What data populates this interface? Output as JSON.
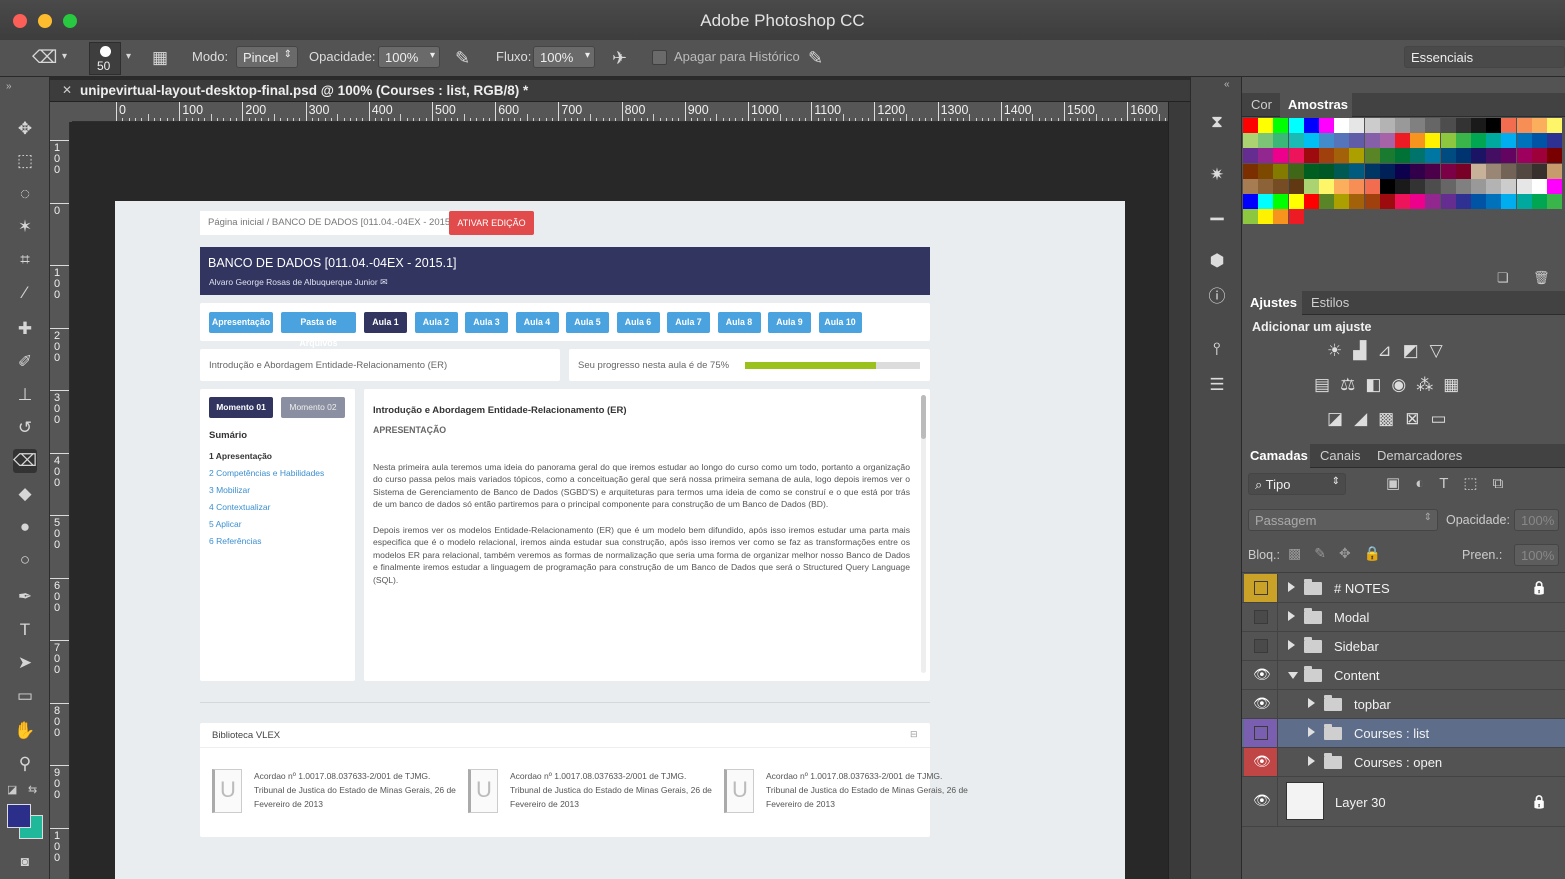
{
  "window": {
    "title": "Adobe Photoshop CC"
  },
  "options": {
    "brush_size": "50",
    "mode_label": "Modo:",
    "mode_value": "Pincel",
    "opacity_label": "Opacidade:",
    "opacity_value": "100%",
    "flow_label": "Fluxo:",
    "flow_value": "100%",
    "erase_history_label": "Apagar para Histórico",
    "workspace": "Essenciais"
  },
  "document": {
    "tab_title": "unipevirtual-layout-desktop-final.psd @ 100% (Courses : list, RGB/8) *",
    "ruler_h": [
      "0",
      "100",
      "200",
      "300",
      "400",
      "500",
      "600",
      "700",
      "800",
      "900",
      "1000",
      "1100",
      "1200",
      "1300",
      "1400",
      "1500",
      "1600"
    ],
    "ruler_v": [
      "100",
      "0",
      "100",
      "200",
      "300",
      "400",
      "500",
      "600",
      "700",
      "800",
      "900",
      "100"
    ]
  },
  "page": {
    "breadcrumb": "Página inicial / BANCO DE DADOS [011.04.-04EX - 2015.1]",
    "edit_button": "ATIVAR EDIÇÃO",
    "course_title": "BANCO DE DADOS [011.04.-04EX - 2015.1]",
    "course_teacher": "Alvaro George Rosas de Albuquerque Junior",
    "lesson_tabs": [
      "Apresentação",
      "Pasta de Arquivos",
      "Aula 1",
      "Aula 2",
      "Aula 3",
      "Aula 4",
      "Aula 5",
      "Aula 6",
      "Aula 7",
      "Aula 8",
      "Aula 9",
      "Aula 10"
    ],
    "active_lesson": "Aula 1",
    "lesson_title": "Introdução e Abordagem Entidade-Relacionamento (ER)",
    "progress_label": "Seu progresso nesta aula é de 75%",
    "progress": 0.75,
    "moments": [
      "Momento 01",
      "Momento 02"
    ],
    "summary_title": "Sumário",
    "summary_items": [
      "1 Apresentação",
      "2 Competências e Habilidades",
      "3 Mobilizar",
      "4 Contextualizar",
      "5 Aplicar",
      "6 Referências"
    ],
    "content_title": "Introdução e Abordagem Entidade-Relacionamento (ER)",
    "content_section": "APRESENTAÇÃO",
    "paragraph1": "Nesta primeira aula teremos uma ideia do panorama geral do que iremos estudar ao longo do curso como um todo, portanto a organização do curso passa pelos mais variados tópicos, como a conceituação geral que será nossa primeira semana de aula, logo depois iremos ver o Sistema de Gerenciamento de Banco de Dados (SGBD'S) e arquiteturas para termos uma ideia de como se construí e o que está por trás de um banco de dados só então partiremos para o principal componente para construção de um Banco de Dados (BD).",
    "paragraph2": "Depois iremos ver os modelos Entidade-Relacionamento (ER) que é um modelo bem difundido, após isso iremos estudar uma parta mais especifica que é o modelo relacional, iremos ainda estudar sua construção, após isso iremos ver como se faz as transformações entre os modelos ER para relacional, também veremos as formas de normalização que seria uma forma de organizar melhor nosso Banco de Dados e finalmente iremos estudar a linguagem de programação para construção de um Banco de Dados que será o Structured Query Language (SQL).",
    "library_title": "Biblioteca VLEX",
    "library_items": [
      "Acordao nº 1.0017.08.037633-2/001 de TJMG. Tribunal de Justica do Estado de Minas Gerais, 26 de Fevereiro de 2013",
      "Acordao nº 1.0017.08.037633-2/001 de TJMG. Tribunal de Justica do Estado de Minas Gerais, 26 de Fevereiro de 2013",
      "Acordao nº 1.0017.08.037633-2/001 de TJMG. Tribunal de Justica do Estado de Minas Gerais, 26 de Fevereiro de 2013"
    ]
  },
  "panels": {
    "color_tabs": [
      "Cor",
      "Amostras"
    ],
    "adjust_tabs": [
      "Ajustes",
      "Estilos"
    ],
    "adjust_heading": "Adicionar um ajuste",
    "layer_tabs": [
      "Camadas",
      "Canais",
      "Demarcadores"
    ],
    "filter_kind": "Tipo",
    "blend_mode": "Passagem",
    "opacity_label": "Opacidade:",
    "opacity_value": "100%",
    "lock_label": "Bloq.:",
    "fill_label": "Preen.:",
    "fill_value": "100%",
    "layers": [
      {
        "name": "# NOTES",
        "color": "#c9a227"
      },
      {
        "name": "Modal"
      },
      {
        "name": "Sidebar"
      },
      {
        "name": "Content"
      },
      {
        "name": "topbar"
      },
      {
        "name": "Courses : list",
        "color": "#7a5fb0"
      },
      {
        "name": "Courses : open",
        "color": "#c04545"
      },
      {
        "name": "Layer 30"
      }
    ]
  },
  "colors": {
    "accent_navy": "#313560",
    "lesson_blue": "#4aa3df",
    "danger": "#e14b4b",
    "progress": "#9bc21c"
  }
}
